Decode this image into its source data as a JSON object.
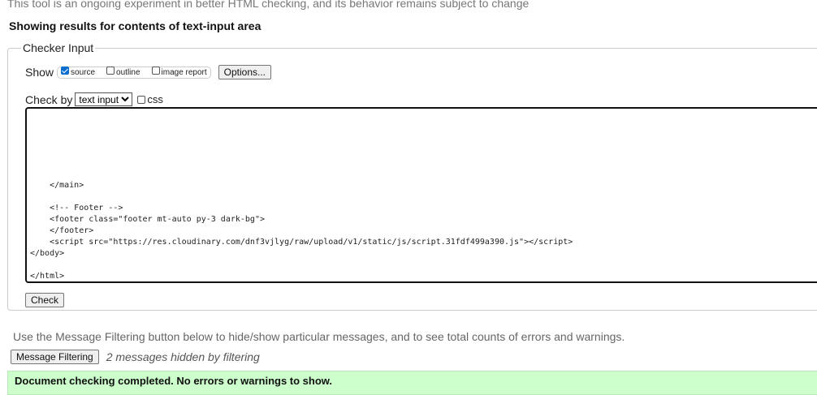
{
  "intro": "This tool is an ongoing experiment in better HTML checking, and its behavior remains subject to change",
  "heading": "Showing results for contents of text-input area",
  "fieldset": {
    "legend": "Checker Input",
    "show_label": "Show",
    "show_options": [
      {
        "label": "source",
        "checked": true
      },
      {
        "label": "outline",
        "checked": false
      },
      {
        "label": "image report",
        "checked": false
      }
    ],
    "options_button": "Options...",
    "check_by_label": "Check by",
    "check_by_value": "text input",
    "css_label": "css",
    "textarea_value": "\n\n\n\n\n\n    </main>\n\n    <!-- Footer -->\n    <footer class=\"footer mt-auto py-3 dark-bg\">\n    </footer>\n    <script src=\"https://res.cloudinary.com/dnf3vjlyg/raw/upload/v1/static/js/script.31fdf499a390.js\"></script>\n</body>\n\n</html>",
    "check_button": "Check"
  },
  "filter_note": "Use the Message Filtering button below to hide/show particular messages, and to see total counts of errors and warnings.",
  "filter_button": "Message Filtering",
  "hidden_count": "2 messages hidden by filtering",
  "success": "Document checking completed. No errors or warnings to show."
}
